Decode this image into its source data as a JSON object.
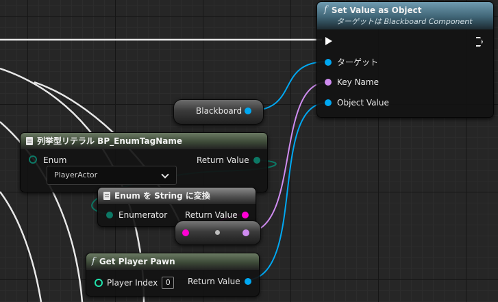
{
  "colors": {
    "object_pin": "#00a8f2",
    "name_pin": "#cf8cf0",
    "enum_pin": "#0c7865",
    "string_pin": "#ff00d4",
    "int_pin": "#21e3ac",
    "exec_pin": "#ffffff",
    "wire_white": "#e8e8e8"
  },
  "set_value_node": {
    "title": "Set Value as Object",
    "subtitle": "ターゲットは Blackboard Component",
    "icon": "function-icon",
    "pins": {
      "target": "ターゲット",
      "key_name": "Key Name",
      "object_value": "Object Value"
    }
  },
  "blackboard_node": {
    "label": "Blackboard"
  },
  "enum_literal_node": {
    "title": "列挙型リテラル BP_EnumTagName",
    "icon": "document-icon",
    "enum_label": "Enum",
    "selected_value": "PlayerActor",
    "output_label": "Return Value"
  },
  "enum_to_string_node": {
    "title": "Enum を String に変換",
    "icon": "document-icon",
    "input_label": "Enumerator",
    "output_label": "Return Value"
  },
  "get_player_pawn_node": {
    "title": "Get Player Pawn",
    "icon": "function-icon",
    "input_label": "Player Index",
    "player_index_value": "0",
    "output_label": "Return Value"
  }
}
